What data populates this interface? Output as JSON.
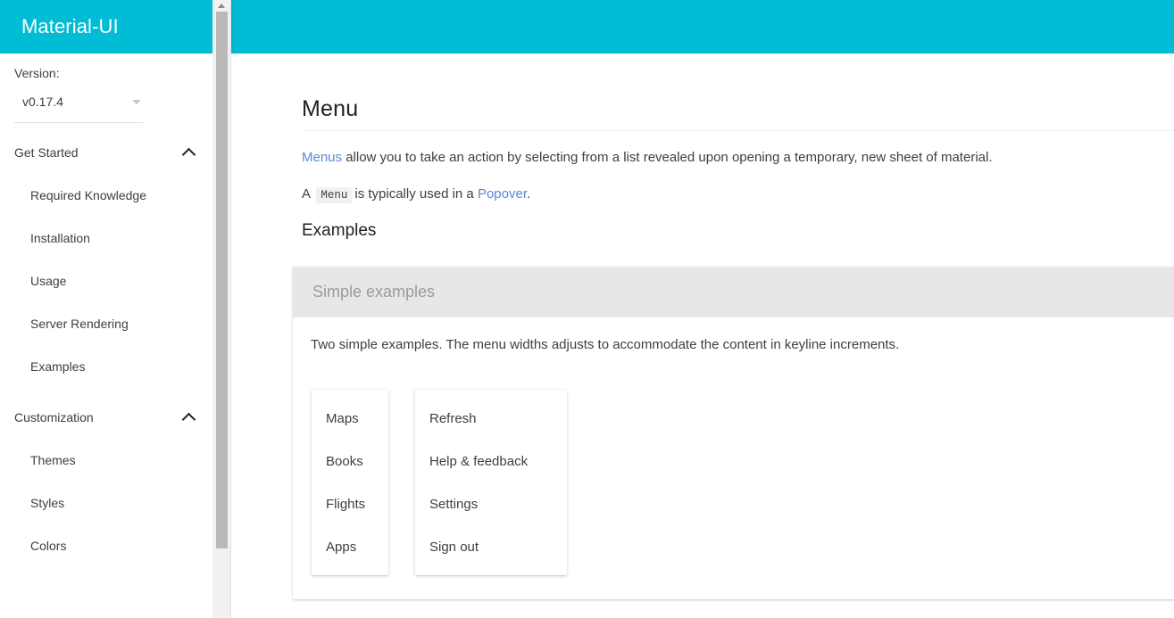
{
  "app": {
    "brand": "Material-UI",
    "accent_color": "#00BCD4",
    "link_color": "#5C85D6",
    "text_color": "#3c4043"
  },
  "sidebar": {
    "version": {
      "label": "Version:",
      "value": "v0.17.4",
      "caret_icon": "chevron-down-icon"
    },
    "groups": [
      {
        "title": "Get Started",
        "chevron_icon": "chevron-up-icon",
        "items": [
          {
            "label": "Required Knowledge"
          },
          {
            "label": "Installation"
          },
          {
            "label": "Usage"
          },
          {
            "label": "Server Rendering"
          },
          {
            "label": "Examples"
          }
        ]
      },
      {
        "title": "Customization",
        "chevron_icon": "chevron-up-icon",
        "items": [
          {
            "label": "Themes"
          },
          {
            "label": "Styles"
          },
          {
            "label": "Colors"
          }
        ]
      }
    ],
    "scrollbar": {
      "arrow_up_icon": "triangle-up-icon"
    }
  },
  "main": {
    "page_title": "Menu",
    "intro": {
      "link1": "Menus",
      "text1": " allow you to take an action by selecting from a list revealed upon opening a temporary, new sheet of material.",
      "text2_prefix": "A ",
      "code": "Menu",
      "text2_middle": "is typically used in a ",
      "link2": "Popover",
      "text2_suffix": "."
    },
    "examples_title": "Examples",
    "example_card": {
      "header_title": "Simple examples",
      "description": "Two simple examples. The menu widths adjusts to accommodate the content in keyline increments.",
      "menus": [
        {
          "name": "short-menu",
          "items": [
            "Maps",
            "Books",
            "Flights",
            "Apps"
          ]
        },
        {
          "name": "long-menu",
          "items": [
            "Refresh",
            "Help & feedback",
            "Settings",
            "Sign out"
          ]
        }
      ]
    }
  }
}
